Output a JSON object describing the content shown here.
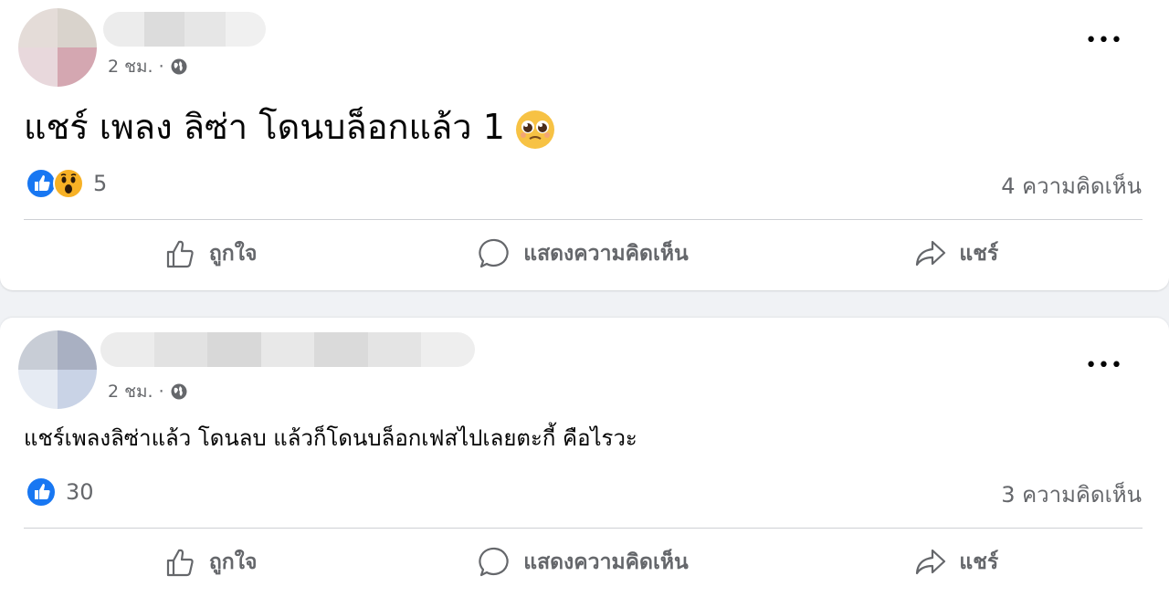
{
  "posts": [
    {
      "time": "2 ชม.",
      "separator": "·",
      "text": "แชร์ เพลง ลิซ่า โดนบล็อกแล้ว 1",
      "emoji": "pleading-face",
      "reaction_icons": [
        "like",
        "wow"
      ],
      "reaction_count": "5",
      "comments": "4 ความคิดเห็น",
      "actions": {
        "like": "ถูกใจ",
        "comment": "แสดงความคิดเห็น",
        "share": "แชร์"
      }
    },
    {
      "time": "2 ชม.",
      "separator": "·",
      "text": "แชร์เพลงลิซ่าแล้ว โดนลบ แล้วก็โดนบล็อกเฟสไปเลยตะกี้ คือไรวะ",
      "reaction_icons": [
        "like"
      ],
      "reaction_count": "30",
      "comments": "3 ความคิดเห็น",
      "actions": {
        "like": "ถูกใจ",
        "comment": "แสดงความคิดเห็น",
        "share": "แชร์"
      }
    }
  ],
  "colors": {
    "background": "#f0f2f5",
    "card": "#ffffff",
    "secondary_text": "#65676b",
    "like_blue": "#1877f2",
    "wow_yellow": "#f7b125"
  }
}
